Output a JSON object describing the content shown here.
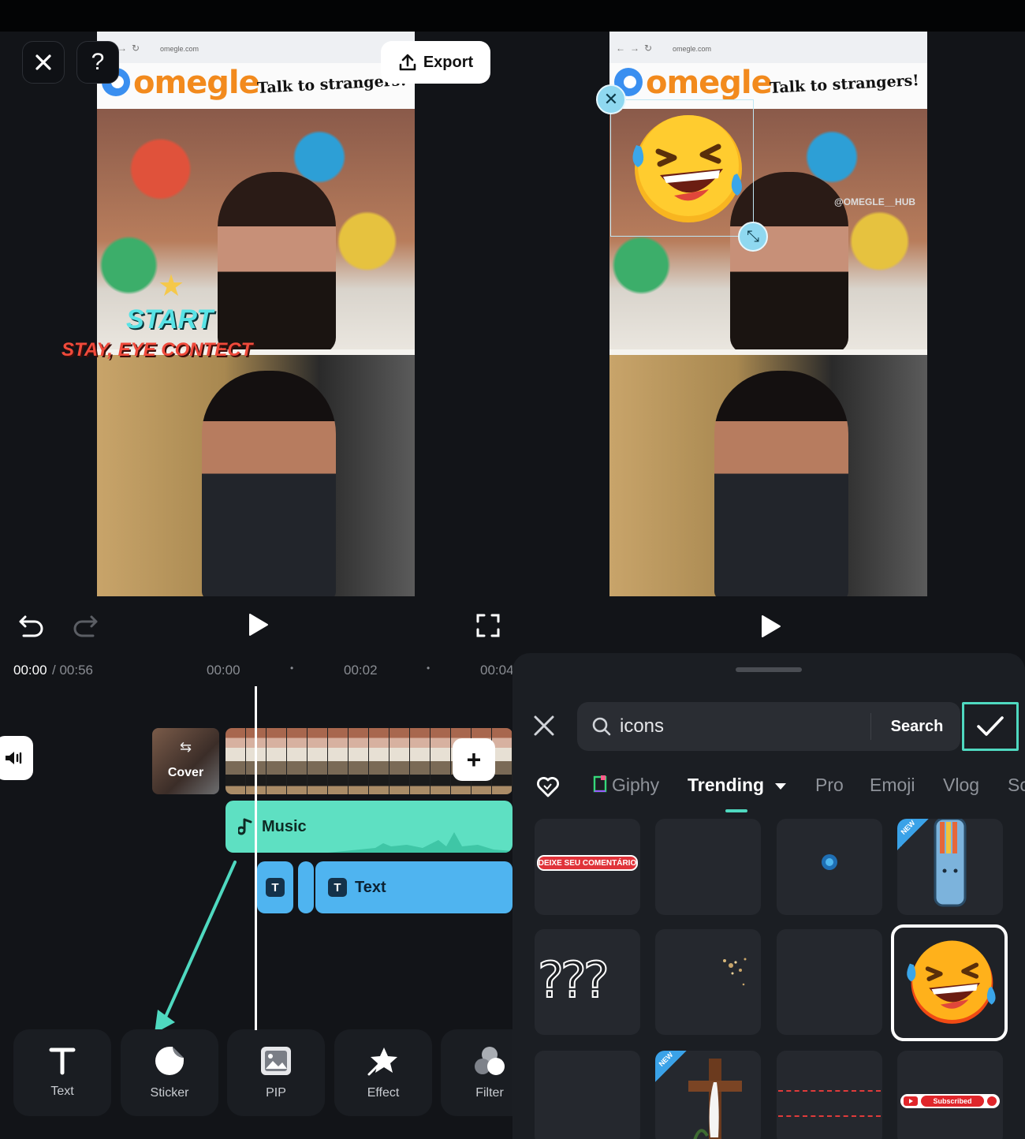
{
  "editor": {
    "export_label": "Export",
    "help_glyph": "?",
    "video_left": {
      "url": "omegle.com",
      "logo": "omegle",
      "tagline": "Talk to strangers!",
      "overlay_start": "START",
      "overlay_eye": "STAY, EYE CONTECT"
    },
    "timeline": {
      "current": "00:00",
      "total": "/ 00:56",
      "markers": [
        "00:00",
        "00:02",
        "00:04"
      ],
      "cover_label": "Cover",
      "music_label": "Music",
      "text_label": "Text",
      "text_badge": "T"
    },
    "tools": [
      {
        "label": "Text",
        "icon": "text-icon"
      },
      {
        "label": "Sticker",
        "icon": "sticker-icon"
      },
      {
        "label": "PIP",
        "icon": "pip-icon"
      },
      {
        "label": "Effect",
        "icon": "effect-icon"
      },
      {
        "label": "Filter",
        "icon": "filter-icon"
      }
    ]
  },
  "preview": {
    "url": "omegle.com",
    "logo": "omegle",
    "tagline": "Talk to strangers!",
    "watermark": "@OMEGLE__HUB"
  },
  "sticker_panel": {
    "search_value": "icons",
    "search_button": "Search",
    "tabs": [
      "Giphy",
      "Trending",
      "Pro",
      "Emoji",
      "Vlog",
      "Sc"
    ],
    "active_tab": "Trending",
    "stickers": {
      "comment_banner": "DEIXE SEU COMENTÁRIO",
      "question_marks": "???",
      "subscribed": "Subscribed",
      "new_badge": "NEW"
    }
  },
  "colors": {
    "accent": "#4fd9c0",
    "music_clip": "#5ee0c2",
    "text_clip": "#4fb4f0",
    "background": "#121418"
  }
}
